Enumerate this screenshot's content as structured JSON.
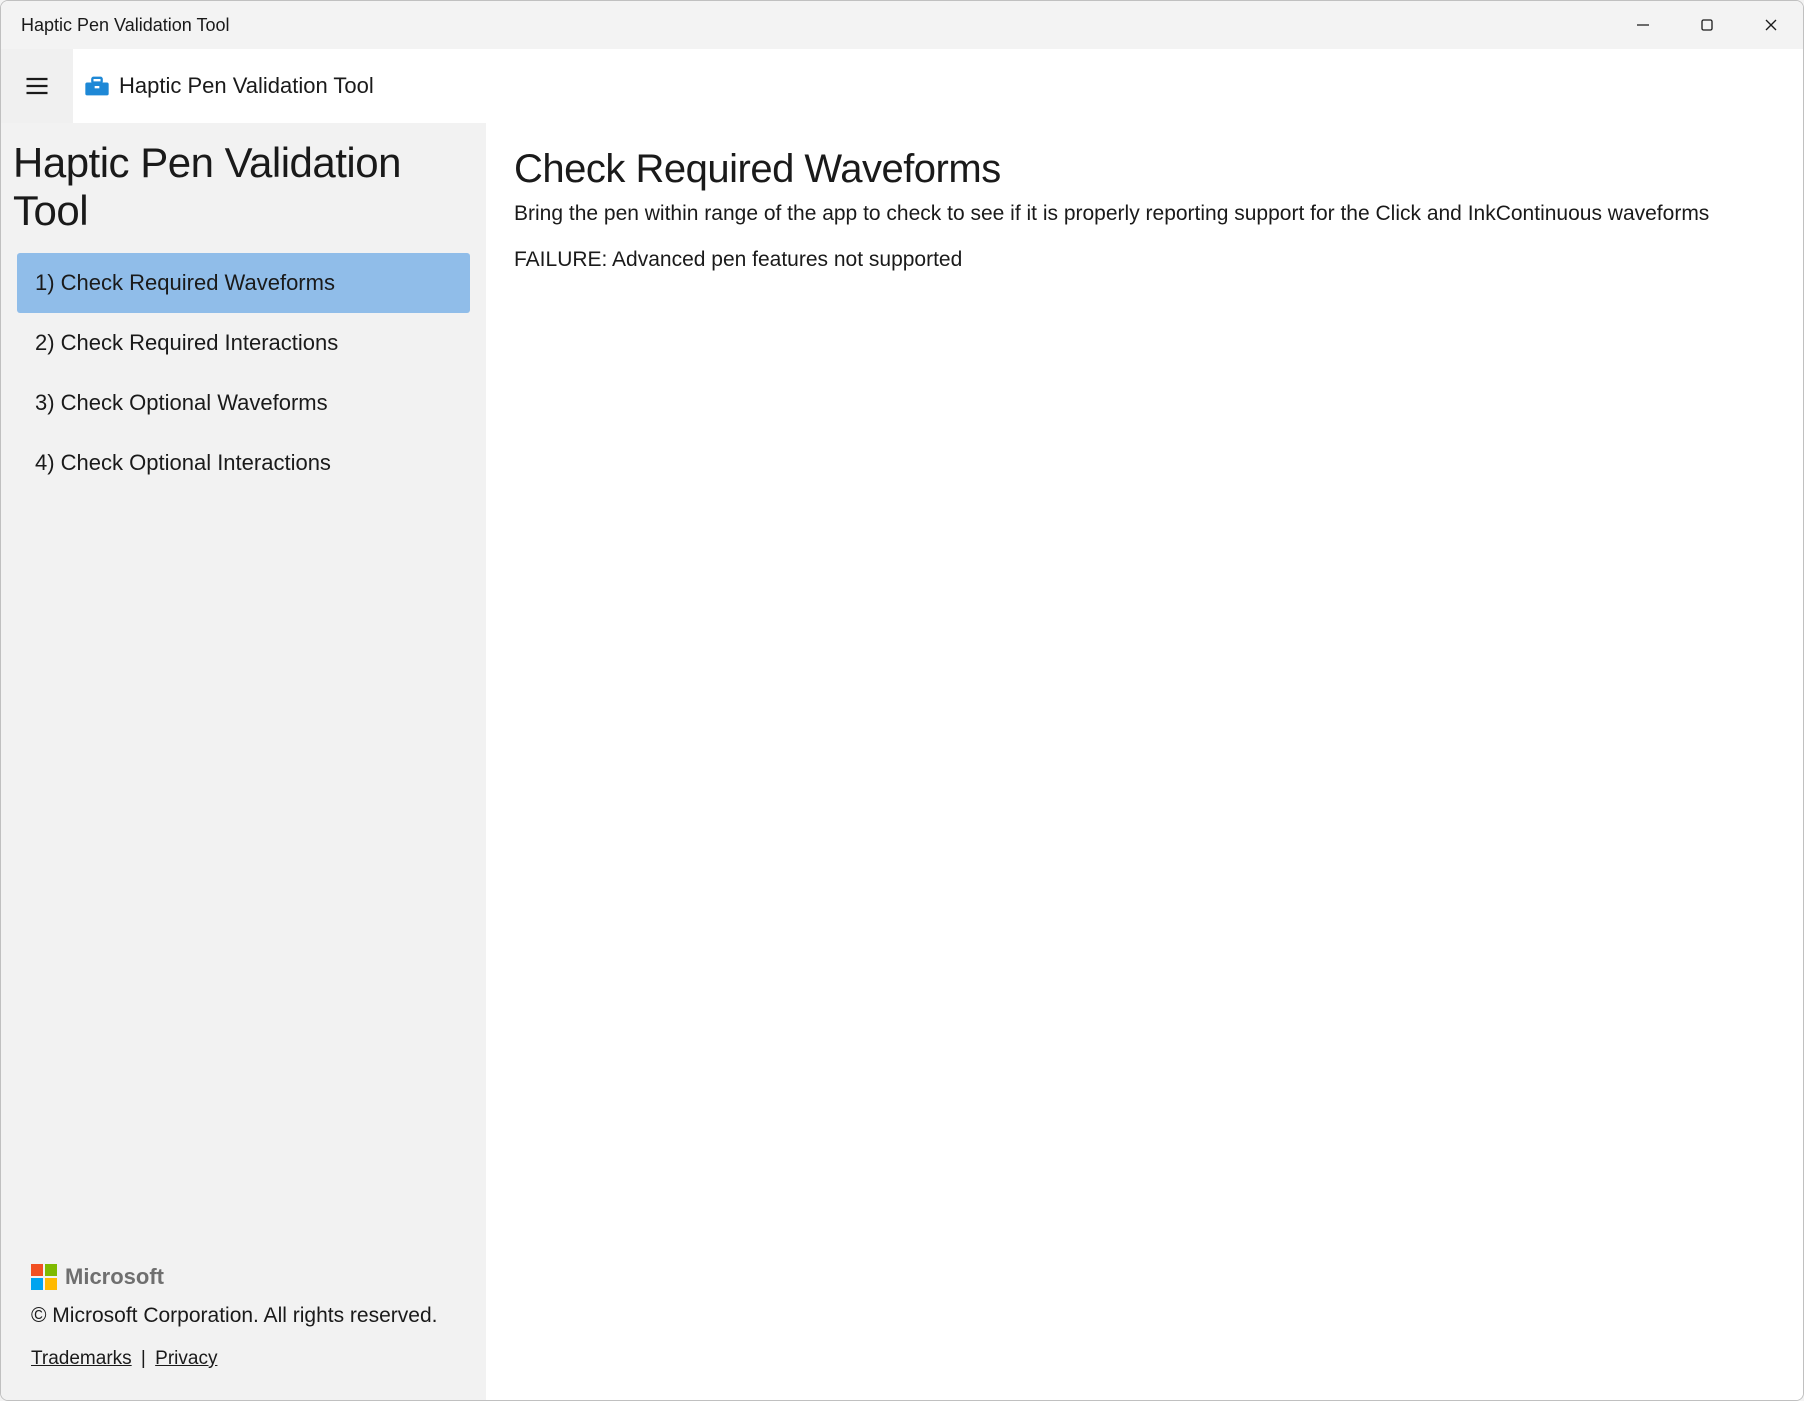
{
  "window": {
    "title": "Haptic Pen Validation Tool"
  },
  "header": {
    "app_name": "Haptic Pen Validation Tool"
  },
  "sidebar": {
    "title": "Haptic Pen Validation Tool",
    "items": [
      {
        "label": "1) Check Required Waveforms",
        "selected": true
      },
      {
        "label": "2) Check Required Interactions",
        "selected": false
      },
      {
        "label": "3) Check Optional Waveforms",
        "selected": false
      },
      {
        "label": "4) Check Optional Interactions",
        "selected": false
      }
    ],
    "footer": {
      "ms_name": "Microsoft",
      "copyright": "© Microsoft Corporation. All rights reserved.",
      "trademarks_label": "Trademarks",
      "privacy_label": "Privacy",
      "separator": " | "
    }
  },
  "content": {
    "title": "Check Required Waveforms",
    "description": "Bring the pen within range of the app to check to see if it is properly reporting support for the Click and InkContinuous waveforms",
    "status": "FAILURE: Advanced pen features not supported"
  }
}
